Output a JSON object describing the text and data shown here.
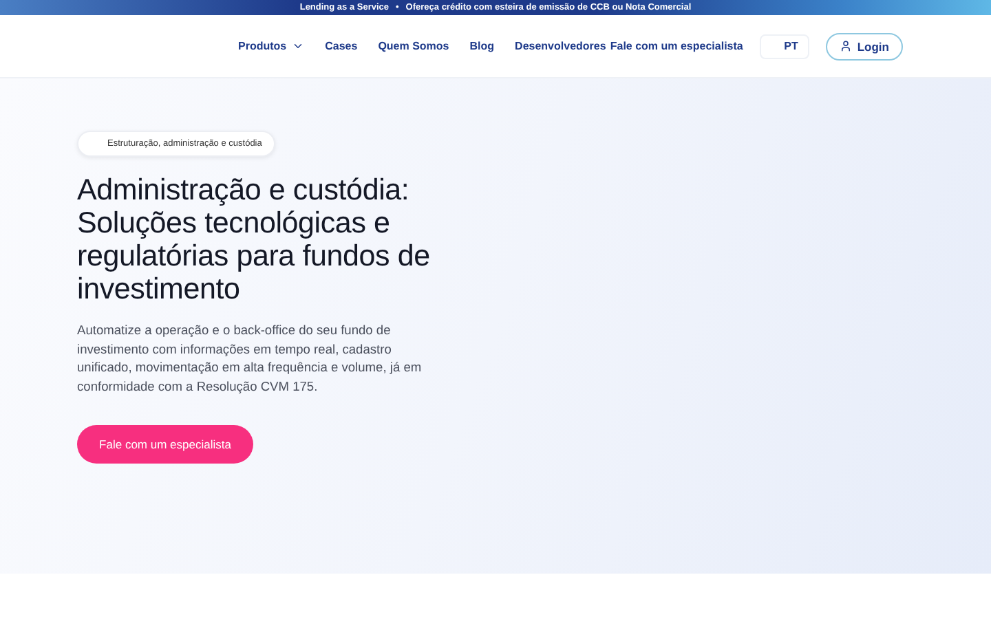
{
  "announcement": {
    "highlight": "Lending as a Service",
    "separator": "•",
    "text": "Ofereça crédito com esteira de emissão de CCB ou Nota Comercial"
  },
  "nav": {
    "items": [
      {
        "label": "Produtos",
        "has_menu": true
      },
      {
        "label": "Cases",
        "has_menu": false
      },
      {
        "label": "Quem Somos",
        "has_menu": false
      },
      {
        "label": "Blog",
        "has_menu": false
      },
      {
        "label": "Desenvolvedores",
        "has_menu": false
      }
    ],
    "contact_link": "Fale com um especialista",
    "language": "PT",
    "login": "Login"
  },
  "hero": {
    "tag": "Estruturação, administração e custódia",
    "title": "Administração e custódia: Soluções tecnológicas e regulatórias para fundos de investimento",
    "description": "Automatize a operação e o back-office do seu fundo de investimento com informações em tempo real, cadastro unificado, movimentação em alta frequência e volume, já em conformidade com a Resolução CVM 175.",
    "cta": "Fale com um especialista"
  }
}
